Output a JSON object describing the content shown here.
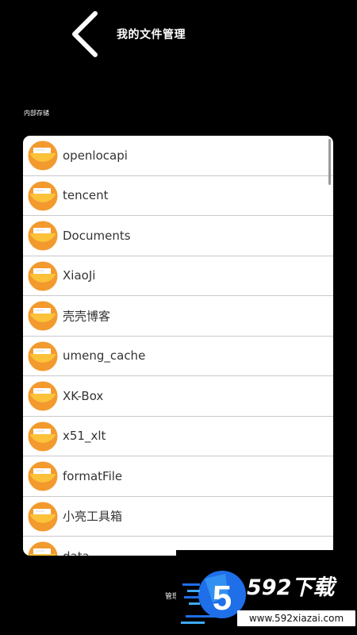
{
  "header": {
    "title": "我的文件管理"
  },
  "section": {
    "label": "内部存储"
  },
  "files": [
    {
      "name": "openlocapi"
    },
    {
      "name": "tencent"
    },
    {
      "name": "Documents"
    },
    {
      "name": "XiaoJi"
    },
    {
      "name": "壳壳博客"
    },
    {
      "name": "umeng_cache"
    },
    {
      "name": "XK-Box"
    },
    {
      "name": "x51_xlt"
    },
    {
      "name": "formatFile"
    },
    {
      "name": "小亮工具箱"
    },
    {
      "name": "data"
    }
  ],
  "footer": {
    "text": "管理"
  },
  "watermark": {
    "title": "592下载",
    "url": "www.592xiazai.com",
    "badge": "5"
  },
  "icons": {
    "back": "chevron-left-icon",
    "folder": "folder-icon"
  },
  "colors": {
    "background": "#000000",
    "list_background": "#ffffff",
    "folder_orange": "#F29A2E",
    "folder_yellow": "#FBC23A",
    "watermark_blue": "#1E6FE8"
  }
}
